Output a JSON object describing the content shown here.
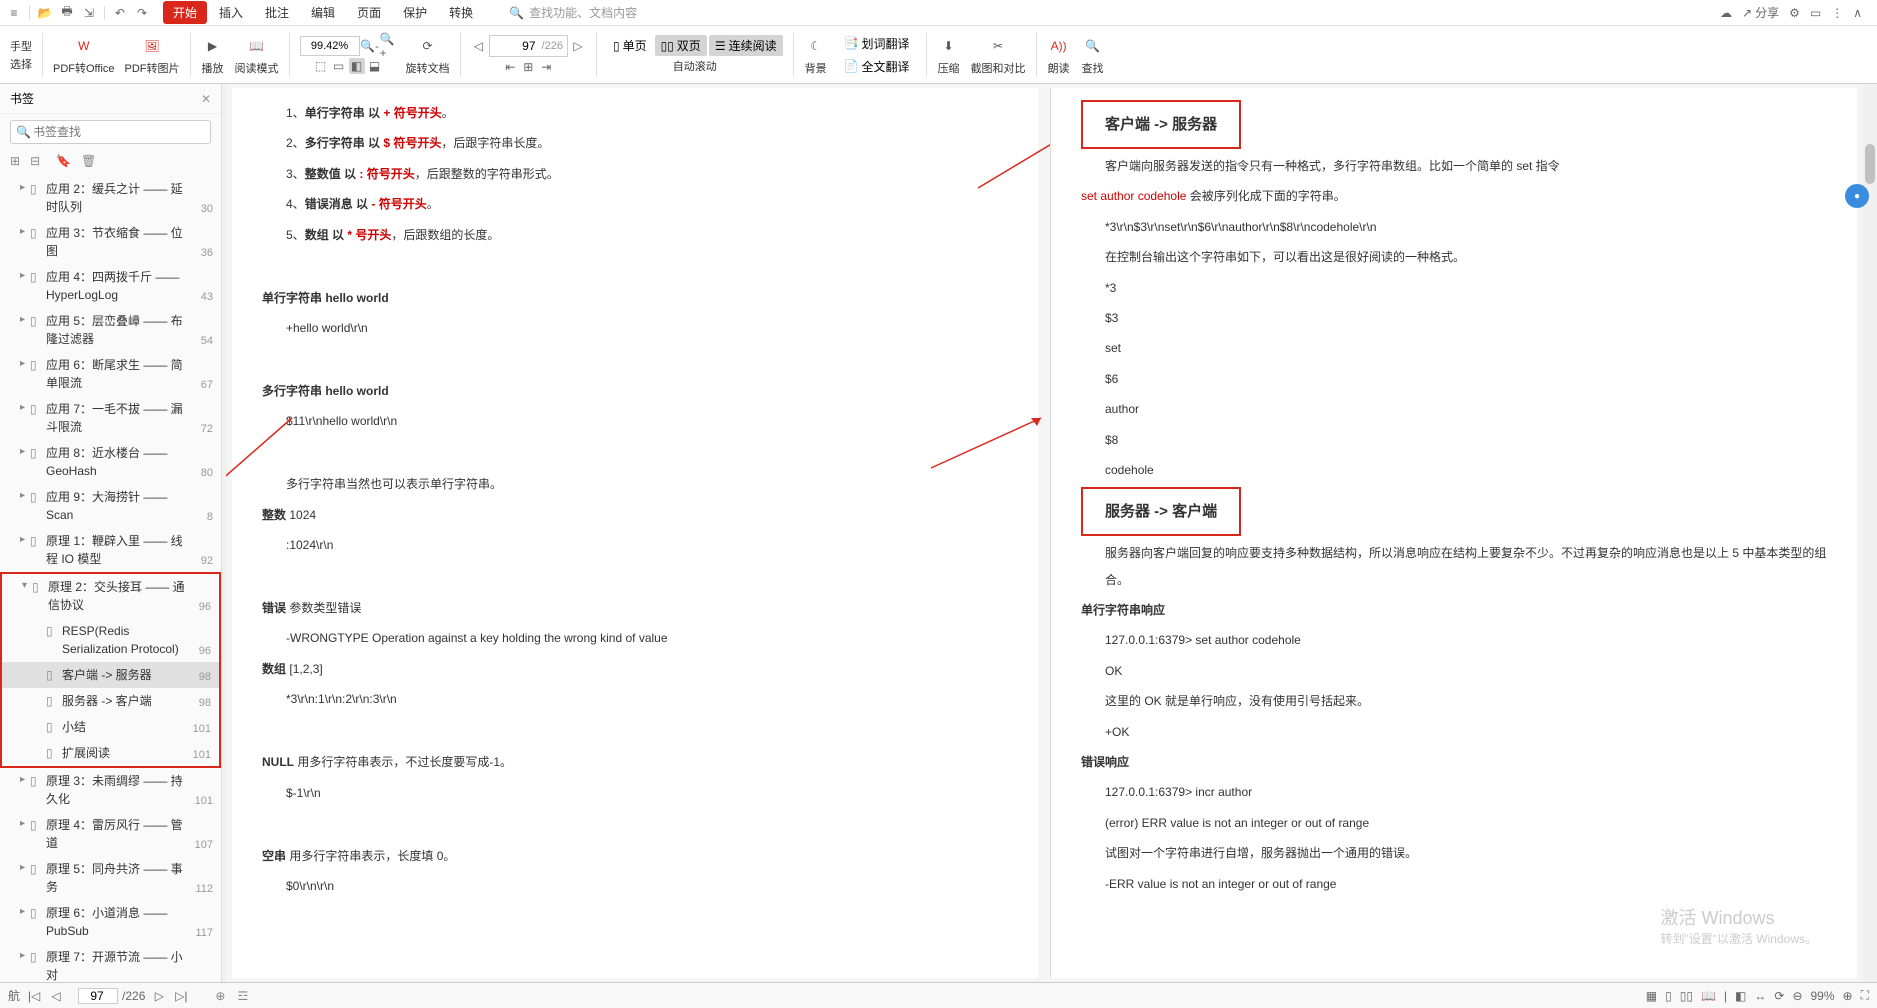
{
  "menubar": {
    "tabs": [
      "开始",
      "插入",
      "批注",
      "编辑",
      "页面",
      "保护",
      "转换"
    ],
    "active": 0,
    "search_placeholder": "查找功能、文档内容",
    "share": "分享"
  },
  "toolbar": {
    "hand_top": "手型",
    "hand_bot": "选择",
    "pdf_office": "PDF转Office",
    "pdf_img": "PDF转图片",
    "play": "播放",
    "read_mode": "阅读模式",
    "zoom_val": "99.42%",
    "rotate": "旋转文档",
    "page_cur": "97",
    "page_total": "/226",
    "single": "单页",
    "double": "双页",
    "continuous": "连续阅读",
    "autoscroll": "自动滚动",
    "bg": "背景",
    "trans1": "划词翻译",
    "trans2": "全文翻译",
    "compress": "压缩",
    "crop": "截图和对比",
    "read_aloud": "朗读",
    "search": "查找"
  },
  "sidebar": {
    "title": "书签",
    "search_placeholder": "书签查找",
    "items": [
      {
        "t": "应用 2：缓兵之计 —— 延时队列",
        "p": "30",
        "l": 1,
        "exp": "▸"
      },
      {
        "t": "应用 3：节衣缩食 —— 位图",
        "p": "36",
        "l": 1,
        "exp": "▸"
      },
      {
        "t": "应用 4：四两拨千斤 —— HyperLogLog",
        "p": "43",
        "l": 1,
        "exp": "▸"
      },
      {
        "t": "应用 5：层峦叠嶂 —— 布隆过滤器",
        "p": "54",
        "l": 1,
        "exp": "▸"
      },
      {
        "t": "应用 6：断尾求生 —— 简单限流",
        "p": "67",
        "l": 1,
        "exp": "▸"
      },
      {
        "t": "应用 7：一毛不拔 —— 漏斗限流",
        "p": "72",
        "l": 1,
        "exp": "▸"
      },
      {
        "t": "应用 8：近水楼台 —— GeoHash",
        "p": "80",
        "l": 1,
        "exp": "▸"
      },
      {
        "t": "应用 9：大海捞针 —— Scan",
        "p": "8",
        "l": 1,
        "exp": "▸"
      },
      {
        "t": "原理 1：鞭辟入里 —— 线程 IO 模型",
        "p": "92",
        "l": 1,
        "exp": "▸"
      },
      {
        "t": "原理 2：交头接耳 —— 通信协议",
        "p": "96",
        "l": 1,
        "exp": "▾",
        "box": true
      },
      {
        "t": "RESP(Redis Serialization Protocol)",
        "p": "96",
        "l": 2,
        "box": true
      },
      {
        "t": "客户端 -> 服务器",
        "p": "98",
        "l": 2,
        "sel": true,
        "box": true
      },
      {
        "t": "服务器 -> 客户端",
        "p": "98",
        "l": 2,
        "box": true
      },
      {
        "t": "小结",
        "p": "101",
        "l": 2,
        "box": true
      },
      {
        "t": "扩展阅读",
        "p": "101",
        "l": 2,
        "box": true
      },
      {
        "t": "原理 3：未雨绸缪 —— 持久化",
        "p": "101",
        "l": 1,
        "exp": "▸"
      },
      {
        "t": "原理 4：雷厉风行 —— 管道",
        "p": "107",
        "l": 1,
        "exp": "▸"
      },
      {
        "t": "原理 5：同舟共济 —— 事务",
        "p": "112",
        "l": 1,
        "exp": "▸"
      },
      {
        "t": "原理 6：小道消息 —— PubSub",
        "p": "117",
        "l": 1,
        "exp": "▸"
      },
      {
        "t": "原理 7：开源节流 —— 小对",
        "p": "",
        "l": 1,
        "exp": "▸"
      }
    ]
  },
  "docL": {
    "l1": {
      "n": "1、",
      "b": "单行字符串 以 ",
      "r": "+ 符号开头",
      "e": "。"
    },
    "l2": {
      "n": "2、",
      "b": "多行字符串 以 ",
      "r": "$ 符号开头",
      "e": "，后跟字符串长度。"
    },
    "l3": {
      "n": "3、",
      "b": "整数值 以 ",
      "r": ": 符号开头",
      "e": "，后跟整数的字符串形式。"
    },
    "l4": {
      "n": "4、",
      "b": "错误消息 以 ",
      "r": "- 符号开头",
      "e": "。"
    },
    "l5": {
      "n": "5、",
      "b": "数组 以 ",
      "r": "* 号开头",
      "e": "，后跟数组的长度。"
    },
    "h1": "单行字符串 hello world",
    "c1": "+hello world\\r\\n",
    "h2": "多行字符串 hello world",
    "c2": "$11\\r\\nhello world\\r\\n",
    "m1": "多行字符串当然也可以表示单行字符串。",
    "h3a": "整数",
    "h3b": "1024",
    "c3": ":1024\\r\\n",
    "h4a": "错误",
    "h4b": "参数类型错误",
    "c4": "-WRONGTYPE Operation against a key holding the wrong kind of value",
    "h5a": "数组",
    "h5b": "[1,2,3]",
    "c5": "*3\\r\\n:1\\r\\n:2\\r\\n:3\\r\\n",
    "h6a": "NULL",
    "h6b": "用多行字符串表示，不过长度要写成-1。",
    "c6": "$-1\\r\\n",
    "h7a": "空串",
    "h7b": "用多行字符串表示，长度填 0。",
    "c7": "$0\\r\\n\\r\\n"
  },
  "docR": {
    "box1": "客户端 -> 服务器",
    "p1a": "客户端向服务器发送的指令只有一种格式，多行字符串数组。比如一个简单的 set 指令",
    "p1r": "set author codehole",
    "p1b": " 会被序列化成下面的字符串。",
    "code1": "*3\\r\\n$3\\r\\nset\\r\\n$6\\r\\nauthor\\r\\n$8\\r\\ncodehole\\r\\n",
    "p2": "在控制台输出这个字符串如下，可以看出这是很好阅读的一种格式。",
    "lines": [
      "*3",
      "$3",
      "set",
      "$6",
      "author",
      "$8",
      "codehole"
    ],
    "box2": "服务器 -> 客户端",
    "p3": "服务器向客户端回复的响应要支持多种数据结构，所以消息响应在结构上要复杂不少。不过再复杂的响应消息也是以上 5 中基本类型的组合。",
    "h1": "单行字符串响应",
    "c1": "127.0.0.1:6379> set author codehole",
    "c2": "OK",
    "p4": "这里的 OK 就是单行响应，没有使用引号括起来。",
    "c3": "+OK",
    "h2": "错误响应",
    "c4": "127.0.0.1:6379> incr author",
    "c5": "(error) ERR value is not an integer or out of range",
    "p5": "试图对一个字符串进行自增，服务器抛出一个通用的错误。",
    "c6": "-ERR value is not an integer or out of range"
  },
  "status": {
    "cur": "97",
    "total": "/226",
    "zoom": "99%"
  },
  "watermark": {
    "l1": "激活 Windows",
    "l2": "转到\"设置\"以激活 Windows。"
  }
}
